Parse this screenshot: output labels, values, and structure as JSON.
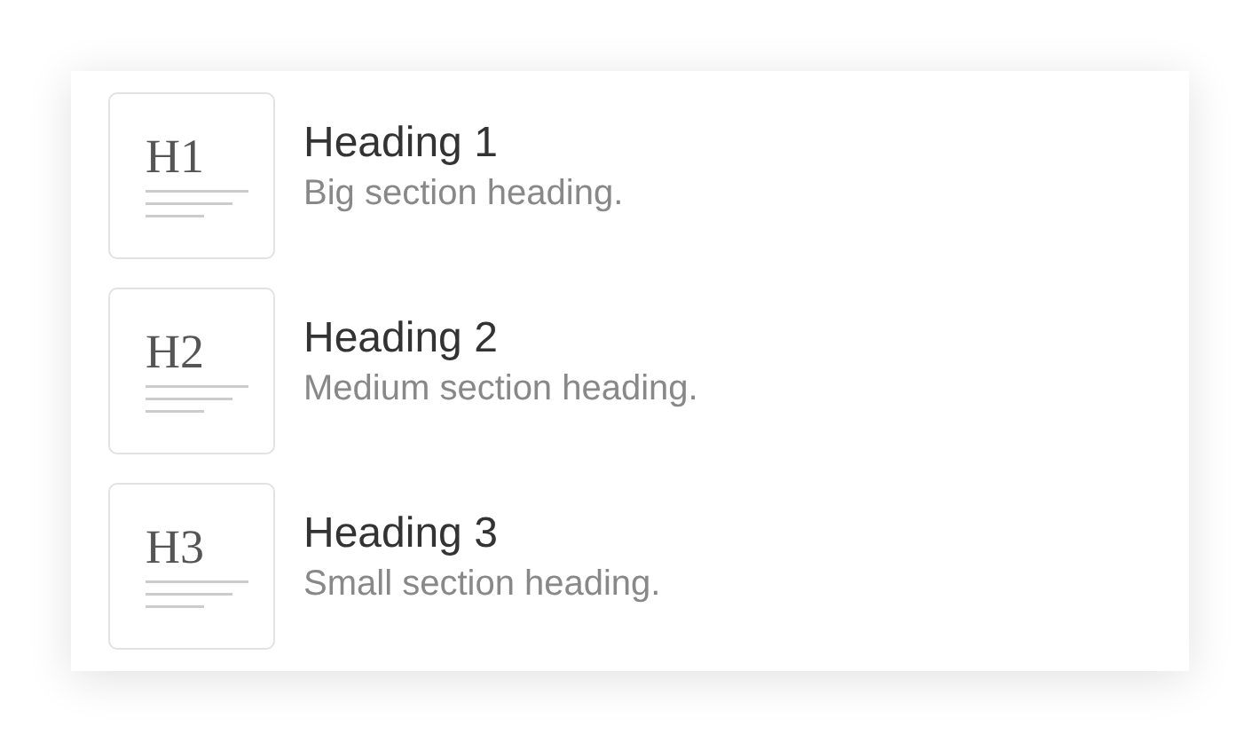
{
  "items": [
    {
      "icon_text": "H1",
      "title": "Heading 1",
      "description": "Big section heading."
    },
    {
      "icon_text": "H2",
      "title": "Heading 2",
      "description": "Medium section heading."
    },
    {
      "icon_text": "H3",
      "title": "Heading 3",
      "description": "Small section heading."
    }
  ]
}
